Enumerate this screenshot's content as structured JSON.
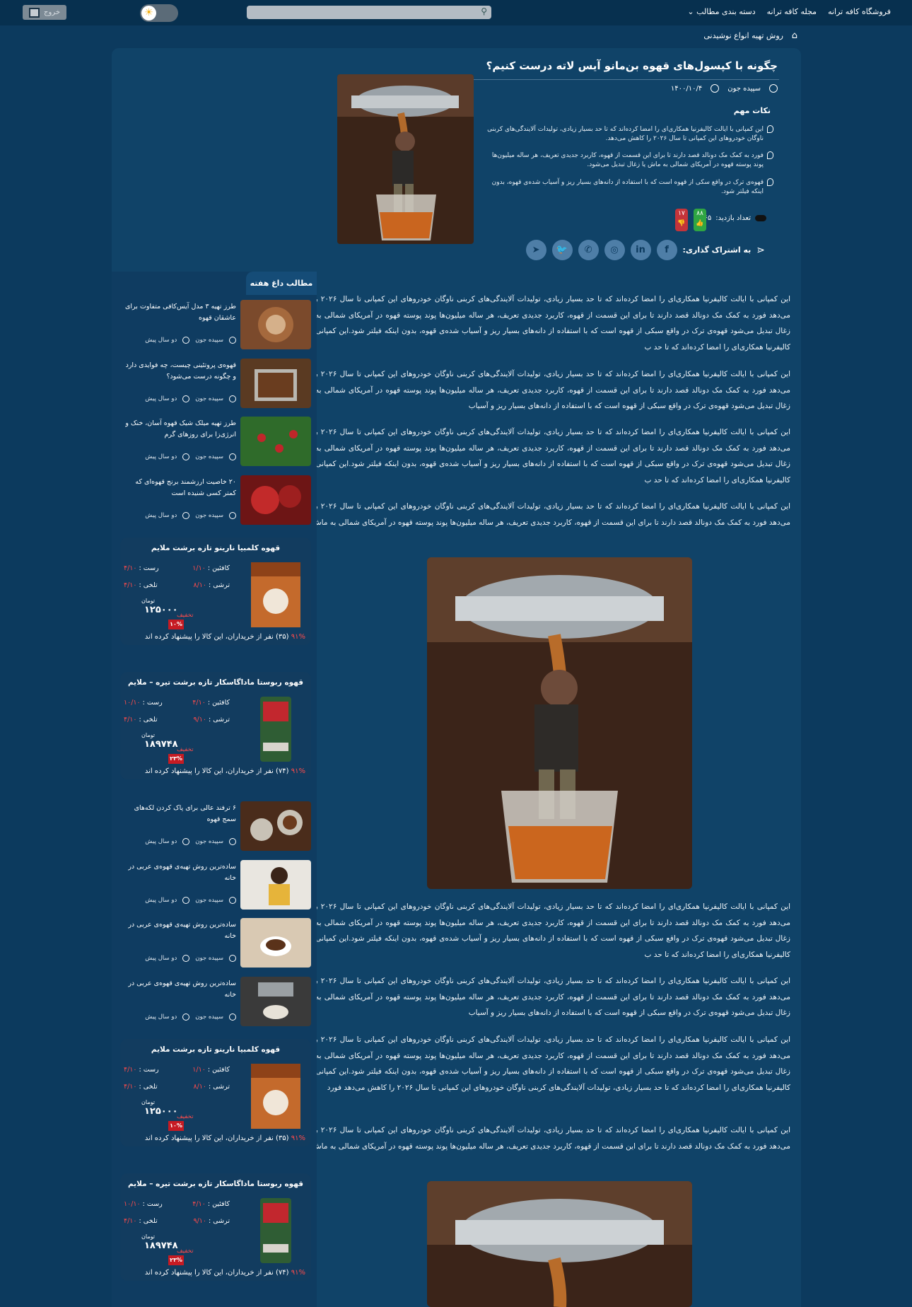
{
  "topbar": {
    "nav": [
      "فروشگاه کافه ترانه",
      "مجله کافه ترانه",
      "دسته بندی مطالب"
    ],
    "logout": "خروج",
    "icons": {
      "search": "search-icon",
      "theme": "sun-icon",
      "logout": "logout-icon"
    }
  },
  "breadcrumb": "روش تهیه انواع نوشیدنی",
  "article": {
    "title": "چگونه با کپسول‌های قهوه بن‌مانو آیس لاته درست کنیم؟",
    "author": "سپیده جون",
    "date": "۱۴۰۰/۱۰/۴",
    "notes_title": "نکات مهم",
    "notes": [
      "این کمپانی با ایالت کالیفرنیا همکاری‌ای را امضا کرده‌اند که تا حد بسیار زیادی، تولیدات آلایندگی‌های کربنی ناوگان خودروهای این کمپانی تا سال ۲۰۲۶ را کاهش می‌دهد.",
      "فورد به کمک مک دونالد قصد دارند تا برای این قسمت از قهوه، کاربرد جدیدی تعریف، هر ساله میلیون‌ها پوند پوسته قهوه در آمریکای شمالی به ماش یا زغال تبدیل می‌شود.",
      "قهوه‌ی ترک در واقع سکی از قهوه است که با استفاده از دانه‌های بسیار ریز و آسیاب شده‌ی قهوه، بدون اینکه فیلتر شود."
    ],
    "views_label": "تعداد بازدید:",
    "views": "۷۶۵",
    "likes": "۸۸",
    "dislikes": "۱۷",
    "share_label": "به اشتراک گذاری:",
    "social": [
      "facebook-icon",
      "linkedin-icon",
      "instagram-icon",
      "whatsapp-icon",
      "twitter-icon",
      "telegram-icon"
    ],
    "paragraphs": [
      "این کمپانی با ایالت کالیفرنیا همکاری‌ای را امضا کرده‌اند که تا حد بسیار زیادی، تولیدات آلایندگی‌های کربنی ناوگان خودروهای این کمپانی تا سال ۲۰۲۶ را کاهش می‌دهد فورد به کمک مک دونالد قصد دارند تا برای این قسمت از قهوه، کاربرد جدیدی تعریف، هر ساله میلیون‌ها پوند پوسته قهوه در آمریکای شمالی به ماش یا زغال تبدیل می‌شود قهوه‌ی ترک در واقع سبکی از قهوه است که با استفاده از دانه‌های بسیار ریز و آسیاب شده‌ی قهوه، بدون اینکه فیلتر شود.این کمپانی با ایالت کالیفرنیا همکاری‌ای را امضا کرده‌اند که تا حد ب",
      "این کمپانی با ایالت کالیفرنیا همکاری‌ای را امضا کرده‌اند که تا حد بسیار زیادی، تولیدات آلایندگی‌های کربنی ناوگان خودروهای این کمپانی تا سال ۲۰۲۶ را کاهش می‌دهد فورد به کمک مک دونالد قصد دارند تا برای این قسمت از قهوه، کاربرد جدیدی تعریف، هر ساله میلیون‌ها پوند پوسته قهوه در آمریکای شمالی به ماش یا زغال تبدیل می‌شود قهوه‌ی ترک در واقع سبکی از قهوه است که با استفاده از دانه‌های بسیار ریز و آسیاب",
      "این کمپانی با ایالت کالیفرنیا همکاری‌ای را امضا کرده‌اند که تا حد بسیار زیادی، تولیدات آلایندگی‌های کربنی ناوگان خودروهای این کمپانی تا سال ۲۰۲۶ را کاهش می‌دهد فورد به کمک مک دونالد قصد دارند تا برای این قسمت از قهوه، کاربرد جدیدی تعریف، هر ساله میلیون‌ها پوند پوسته قهوه در آمریکای شمالی به ماش یا زغال تبدیل می‌شود قهوه‌ی ترک در واقع سبکی از قهوه است که با استفاده از دانه‌های بسیار ریز و آسیاب شده‌ی قهوه، بدون اینکه فیلتر شود.این کمپانی با ایالت کالیفرنیا همکاری‌ای را امضا کرده‌اند که تا حد ب",
      "این کمپانی با ایالت کالیفرنیا همکاری‌ای را امضا کرده‌اند که تا حد بسیار زیادی، تولیدات آلایندگی‌های کربنی ناوگان خودروهای این کمپانی تا سال ۲۰۲۶ را کاهش می‌دهد فورد به کمک مک دونالد قصد دارند تا برای این قسمت از قهوه، کاربرد جدیدی تعریف، هر ساله میلیون‌ها پوند پوسته قهوه در آمریکای شمالی به ماش ی",
      "این کمپانی با ایالت کالیفرنیا همکاری‌ای را امضا کرده‌اند که تا حد بسیار زیادی، تولیدات آلایندگی‌های کربنی ناوگان خودروهای این کمپانی تا سال ۲۰۲۶ را کاهش می‌دهد فورد به کمک مک دونالد قصد دارند تا برای این قسمت از قهوه، کاربرد جدیدی تعریف، هر ساله میلیون‌ها پوند پوسته قهوه در آمریکای شمالی به ماش یا زغال تبدیل می‌شود قهوه‌ی ترک در واقع سبکی از قهوه است که با استفاده از دانه‌های بسیار ریز و آسیاب شده‌ی قهوه، بدون اینکه فیلتر شود.این کمپانی با ایالت کالیفرنیا همکاری‌ای را امضا کرده‌اند که تا حد ب",
      "این کمپانی با ایالت کالیفرنیا همکاری‌ای را امضا کرده‌اند که تا حد بسیار زیادی، تولیدات آلایندگی‌های کربنی ناوگان خودروهای این کمپانی تا سال ۲۰۲۶ را کاهش می‌دهد فورد به کمک مک دونالد قصد دارند تا برای این قسمت از قهوه، کاربرد جدیدی تعریف، هر ساله میلیون‌ها پوند پوسته قهوه در آمریکای شمالی به ماش یا زغال تبدیل می‌شود قهوه‌ی ترک در واقع سبکی از قهوه است که با استفاده از دانه‌های بسیار ریز و آسیاب",
      "این کمپانی با ایالت کالیفرنیا همکاری‌ای را امضا کرده‌اند که تا حد بسیار زیادی، تولیدات آلایندگی‌های کربنی ناوگان خودروهای این کمپانی تا سال ۲۰۲۶ را کاهش می‌دهد فورد به کمک مک دونالد قصد دارند تا برای این قسمت از قهوه، کاربرد جدیدی تعریف، هر ساله میلیون‌ها پوند پوسته قهوه در آمریکای شمالی به ماش یا زغال تبدیل می‌شود قهوه‌ی ترک در واقع سبکی از قهوه است که با استفاده از دانه‌های بسیار ریز و آسیاب شده‌ی قهوه، بدون اینکه فیلتر شود.این کمپانی با ایالت کالیفرنیا همکاری‌ای را امضا کرده‌اند که تا حد بسیار زیادی، تولیدات آلایندگی‌های کربنی ناوگان خودروهای این کمپانی تا سال ۲۰۲۶ را کاهش می‌دهد فورد",
      "این کمپانی با ایالت کالیفرنیا همکاری‌ای را امضا کرده‌اند که تا حد بسیار زیادی، تولیدات آلایندگی‌های کربنی ناوگان خودروهای این کمپانی تا سال ۲۰۲۶ را کاهش می‌دهد فورد به کمک مک دونالد قصد دارند تا برای این قسمت از قهوه، کاربرد جدیدی تعریف، هر ساله میلیون‌ها پوند پوسته قهوه در آمریکای شمالی به ماش ی"
    ]
  },
  "sidebar": {
    "heading": "مطالب داغ هفته",
    "posts": [
      {
        "title": "طرز تهیه ۳ مدل آیس‌کافی متفاوت برای عاشقان قهوه",
        "author": "سپیده جون",
        "time": "دو سال پیش"
      },
      {
        "title": "قهوه‌ی پروتئینی چیست، چه فوایدی دارد و چگونه درست می‌شود؟",
        "author": "سپیده جون",
        "time": "دو سال پیش"
      },
      {
        "title": "طرز تهیه میلک شیک قهوه آسان، خنک و انرژی‌زا برای روزهای گرم",
        "author": "سپیده جون",
        "time": "دو سال پیش"
      },
      {
        "title": "۲۰ خاصیت ارزشمند برنج قهوه‌ای که کمتر کسی شنیده است",
        "author": "سپیده جون",
        "time": "دو سال پیش"
      },
      {
        "title": "۶ ترفند عالی برای پاک کردن لکه‌های سمج قهوه",
        "author": "سپیده جون",
        "time": "دو سال پیش"
      },
      {
        "title": "ساده‌ترین روش تهیه‌ی قهوه‌ی عربی در خانه",
        "author": "سپیده جون",
        "time": "دو سال پیش"
      },
      {
        "title": "ساده‌ترین روش تهیه‌ی قهوه‌ی عربی در خانه",
        "author": "سپیده جون",
        "time": "دو سال پیش"
      },
      {
        "title": "ساده‌ترین روش تهیه‌ی قهوه‌ی عربی در خانه",
        "author": "سپیده جون",
        "time": "دو سال پیش"
      }
    ],
    "products": [
      {
        "title": "قهوه کلمبیا نارینو تازه برشت ملایم",
        "caffeine_label": "کافئین :",
        "caffeine": "۱/۱۰",
        "roast_label": "رست :",
        "roast": "۴/۱۰",
        "acidity_label": "ترشی :",
        "acidity": "۸/۱۰",
        "bitter_label": "تلخی :",
        "bitter": "۴/۱۰",
        "discount_label": "تخفیف",
        "discount": "۱۰%",
        "price": "۱۲۵۰۰۰",
        "currency": "تومان",
        "rec": "(۳۵) نفر از خریداران، این کالا را پیشنهاد کرده اند",
        "rec_pct": "۹۱%"
      },
      {
        "title": "قهوه ربوستا ماداگاسکار تازه برشت تیره – ملایم",
        "caffeine_label": "کافئین :",
        "caffeine": "۴/۱۰",
        "roast_label": "رست :",
        "roast": "۱۰/۱۰",
        "acidity_label": "ترشی :",
        "acidity": "۹/۱۰",
        "bitter_label": "تلخی :",
        "bitter": "۴/۱۰",
        "discount_label": "تخفیف",
        "discount": "۲۳%",
        "price": "۱۸۹۷۴۸",
        "currency": "تومان",
        "rec": "(۷۴) نفر از خریداران، این کالا را پیشنهاد کرده اند",
        "rec_pct": "۹۱%"
      },
      {
        "title": "قهوه کلمبیا نارینو تازه برشت ملایم",
        "caffeine_label": "کافئین :",
        "caffeine": "۱/۱۰",
        "roast_label": "رست :",
        "roast": "۴/۱۰",
        "acidity_label": "ترشی :",
        "acidity": "۸/۱۰",
        "bitter_label": "تلخی :",
        "bitter": "۴/۱۰",
        "discount_label": "تخفیف",
        "discount": "۱۰%",
        "price": "۱۲۵۰۰۰",
        "currency": "تومان",
        "rec": "(۳۵) نفر از خریداران، این کالا را پیشنهاد کرده اند",
        "rec_pct": "۹۱%"
      },
      {
        "title": "قهوه ربوستا ماداگاسکار تازه برشت تیره – ملایم",
        "caffeine_label": "کافئین :",
        "caffeine": "۴/۱۰",
        "roast_label": "رست :",
        "roast": "۱۰/۱۰",
        "acidity_label": "ترشی :",
        "acidity": "۹/۱۰",
        "bitter_label": "تلخی :",
        "bitter": "۴/۱۰",
        "discount_label": "تخفیف",
        "discount": "۲۳%",
        "price": "۱۸۹۷۴۸",
        "currency": "تومان",
        "rec": "(۷۴) نفر از خریداران، این کالا را پیشنهاد کرده اند",
        "rec_pct": "۹۱%"
      }
    ]
  },
  "colors": {
    "background": "#0c3a5e",
    "panel": "#104368",
    "topbar": "#07304f",
    "accent_red": "#ff4b4b",
    "like_green": "#2fa543",
    "dislike_red": "#c4343a"
  }
}
